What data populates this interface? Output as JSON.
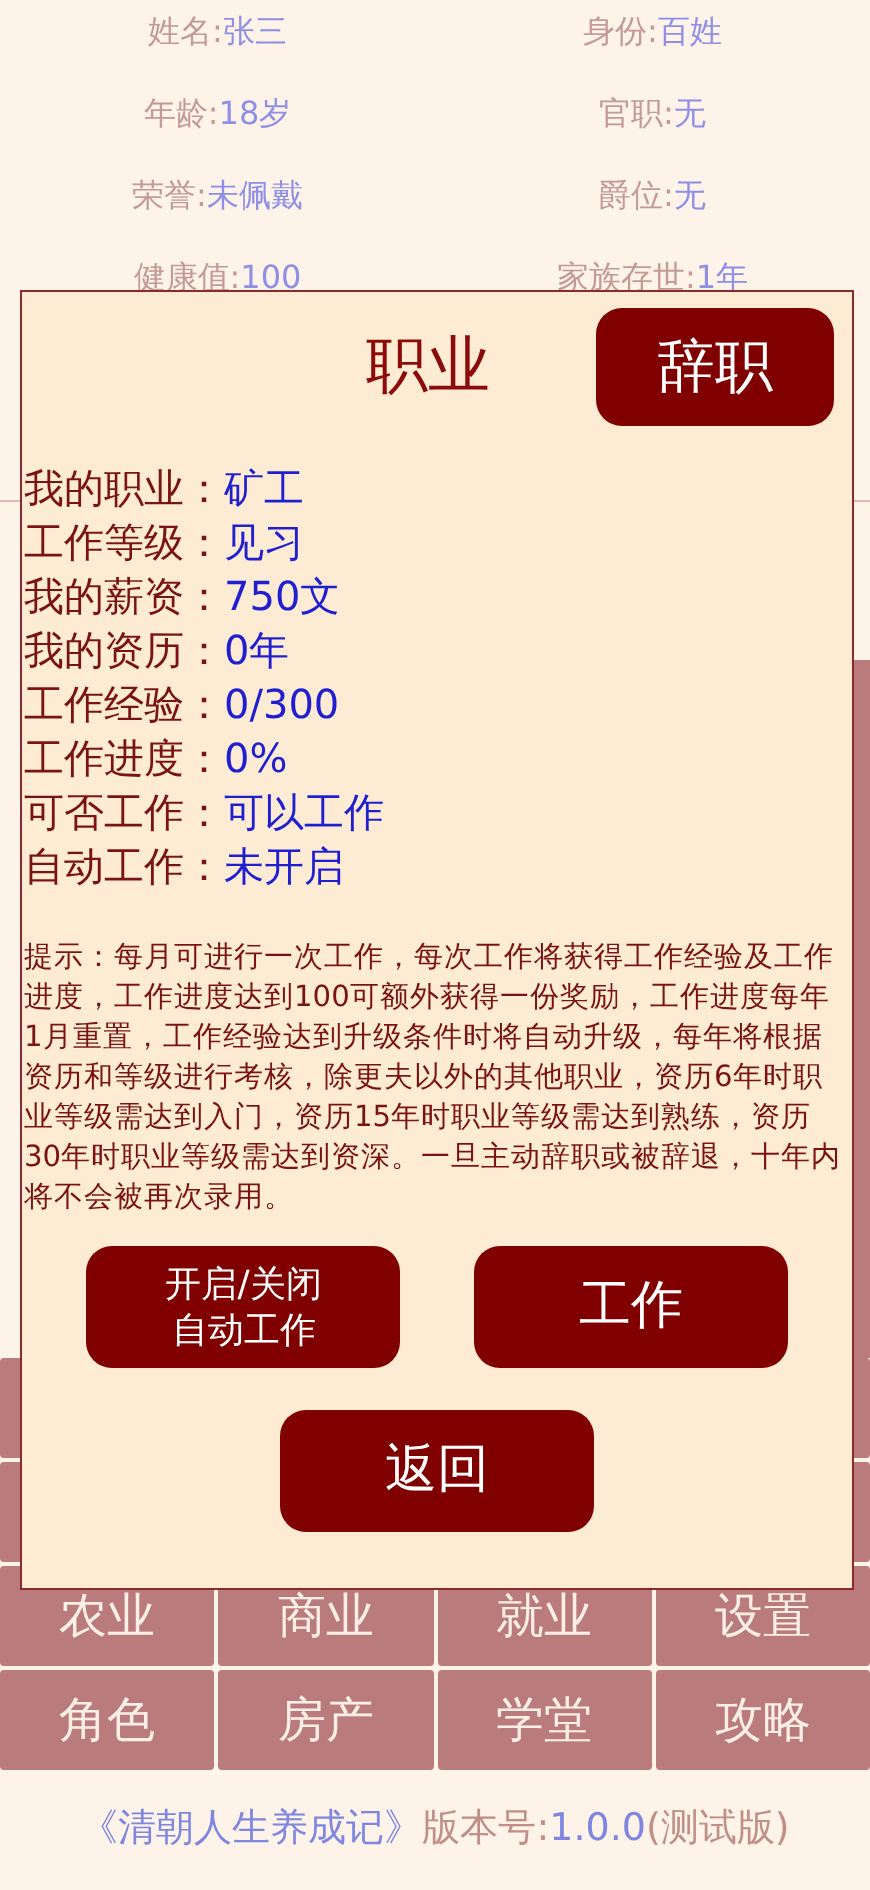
{
  "profile": [
    {
      "label": "姓名:",
      "value": "张三"
    },
    {
      "label": "身份:",
      "value": "百姓"
    },
    {
      "label": "年龄:",
      "value": "18岁"
    },
    {
      "label": "官职:",
      "value": "无"
    },
    {
      "label": "荣誉:",
      "value": "未佩戴"
    },
    {
      "label": "爵位:",
      "value": "无"
    },
    {
      "label": "健康值:",
      "value": "100"
    },
    {
      "label": "家族存世:",
      "value": "1年"
    }
  ],
  "menu": [
    "农业",
    "商业",
    "就业",
    "设置",
    "角色",
    "房产",
    "学堂",
    "攻略"
  ],
  "footer": [
    {
      "kind": "title",
      "text": "《清朝人生养成记》"
    },
    {
      "kind": "label",
      "text": "版本号:"
    },
    {
      "kind": "value",
      "text": "1.0.0"
    },
    {
      "kind": "label",
      "text": "(测试版)"
    }
  ],
  "dialog": {
    "title": "职业",
    "resign_button": "辞职",
    "fields": [
      {
        "label": "我的职业：",
        "value": "矿工"
      },
      {
        "label": "工作等级：",
        "value": "见习"
      },
      {
        "label": "我的薪资：",
        "value": "750文"
      },
      {
        "label": "我的资历：",
        "value": "0年"
      },
      {
        "label": "工作经验：",
        "value": "0/300"
      },
      {
        "label": "工作进度：",
        "value": "0%"
      },
      {
        "label": "可否工作：",
        "value": "可以工作"
      },
      {
        "label": "自动工作：",
        "value": "未开启"
      }
    ],
    "hint": "提示：每月可进行一次工作，每次工作将获得工作经验及工作进度，工作进度达到100可额外获得一份奖励，工作进度每年1月重置，工作经验达到升级条件时将自动升级，每年将根据资历和等级进行考核，除更夫以外的其他职业，资历6年时职业等级需达到入门，资历15年时职业等级需达到熟练，资历30年时职业等级需达到资深。一旦主动辞职或被辞退，十年内将不会被再次录用。",
    "auto_button": [
      "开启/关闭",
      "自动工作"
    ],
    "work_button": "工作",
    "back_button": "返回"
  }
}
